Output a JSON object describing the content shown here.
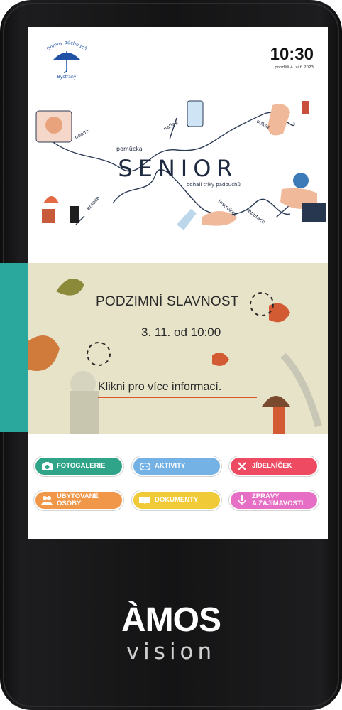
{
  "logo": {
    "text_top": "Domov důchodců",
    "text_bottom": "Bystřany"
  },
  "clock": {
    "time": "10:30",
    "date": "pondělí 4. září 2023"
  },
  "senior_graphic": {
    "title": "SENIOR",
    "labels": [
      "pomůcka",
      "nátlak",
      "odkaz",
      "hodiny",
      "emoce",
      "odhalí triky padouchů",
      "instrukce",
      "reputace"
    ]
  },
  "banner": {
    "title": "PODZIMNÍ SLAVNOST",
    "when": "3. 11. od 10:00",
    "more": "Klikni pro více informací."
  },
  "buttons": [
    {
      "label": "FOTOGALERIE",
      "color": "#2fa488",
      "icon": "camera-icon"
    },
    {
      "label": "AKTIVITY",
      "color": "#74b2e6",
      "icon": "gamepad-icon"
    },
    {
      "label": "JÍDELNÍČEK",
      "color": "#ee4b63",
      "icon": "cutlery-icon"
    },
    {
      "label": "UBYTOVANÉ\nOSOBY",
      "color": "#f1974a",
      "icon": "people-icon"
    },
    {
      "label": "DOKUMENTY",
      "color": "#f0ca37",
      "icon": "book-icon"
    },
    {
      "label": "ZPRÁVY\nA ZAJÍMAVOSTI",
      "color": "#e66ec4",
      "icon": "microphone-icon"
    }
  ],
  "navbar": {
    "home": "🏠",
    "back": "←",
    "forward": "→",
    "up": "↑",
    "down": "↓",
    "zoom_in": "⊕",
    "zoom_out": "⊖",
    "keyboard": "⌨",
    "icons": [
      "home-icon",
      "arrow-left-icon",
      "arrow-right-icon",
      "arrow-up-icon",
      "arrow-down-icon",
      "zoom-in-icon",
      "zoom-out-icon",
      "keyboard-icon"
    ]
  },
  "brand": {
    "name": "ÀMOS",
    "sub": "vision"
  },
  "colors": {
    "teal_tab": "#2aa89d",
    "banner_bg": "#e7e3c8",
    "accent_underline": "#d9572b"
  }
}
